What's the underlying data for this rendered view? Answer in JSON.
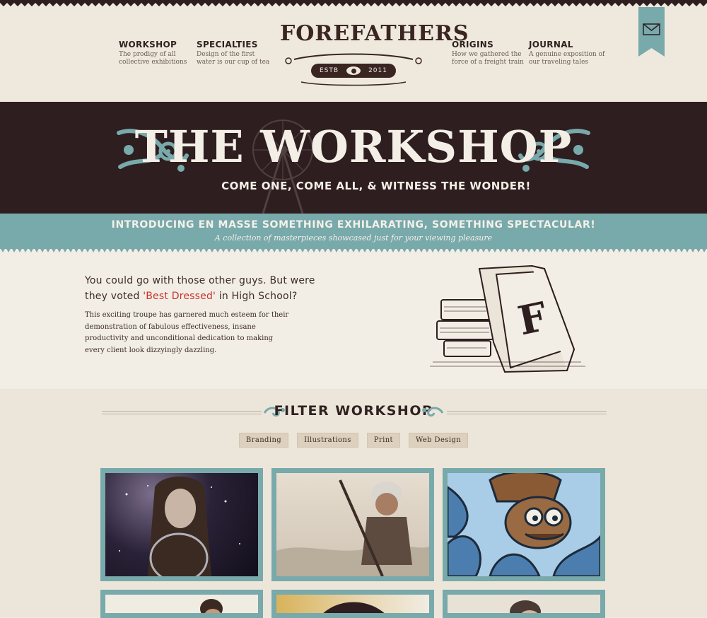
{
  "nav": {
    "left": [
      {
        "title": "WORKSHOP",
        "desc": "The prodigy of all collective exhibitions"
      },
      {
        "title": "SPECIALTIES",
        "desc": "Design of the first water is our cup of tea"
      }
    ],
    "right": [
      {
        "title": "ORIGINS",
        "desc": "How we gathered the force of a freight train"
      },
      {
        "title": "JOURNAL",
        "desc": "A genuine exposition of our traveling tales"
      }
    ]
  },
  "logo": {
    "name": "FOREFATHERS",
    "estb": "ESTB",
    "year": "2011"
  },
  "hero": {
    "title": "THE WORKSHOP",
    "subtitle": "COME ONE, COME ALL, & WITNESS THE WONDER!"
  },
  "band": {
    "title": "INTRODUCING EN MASSE SOMETHING EXHILARATING, SOMETHING SPECTACULAR!",
    "subtitle": "A collection of masterpieces showcased just for your viewing pleasure"
  },
  "intro": {
    "heading_pre": "You could go with those other guys. But were they voted ",
    "heading_highlight": "'Best Dressed'",
    "heading_post": " in High School?",
    "body": "This exciting troupe has garnered much esteem for their demonstration of fabulous effectiveness, insane productivity and unconditional dedication to making every client look dizzyingly dazzling."
  },
  "filter": {
    "title": "FILTER WORKSHOP",
    "buttons": [
      "Branding",
      "Illustrations",
      "Print",
      "Web Design"
    ]
  },
  "colors": {
    "teal": "#78a9ab",
    "dark_brown": "#2e1e1f",
    "cream": "#efe9dd",
    "highlight_red": "#c6342d"
  },
  "icons": {
    "ribbon": "envelope-icon"
  }
}
